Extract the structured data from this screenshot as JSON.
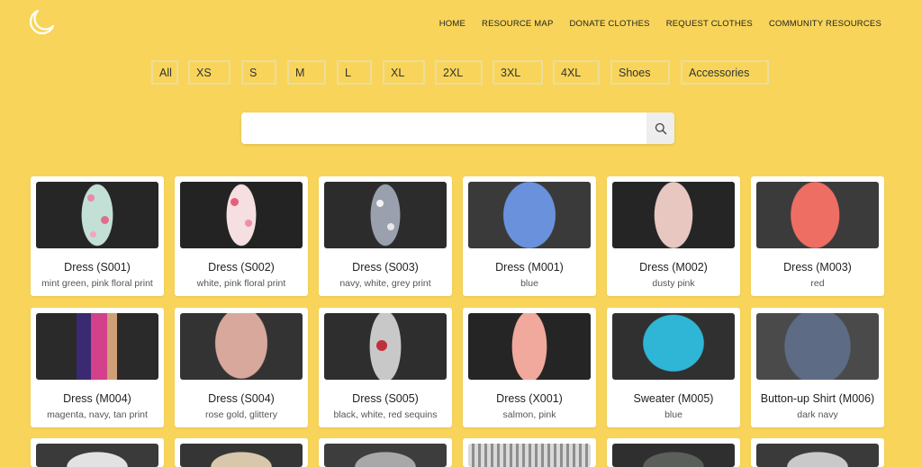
{
  "nav": {
    "home": "HOME",
    "resource_map": "RESOURCE MAP",
    "donate": "DONATE CLOTHES",
    "request": "REQUEST CLOTHES",
    "community": "COMMUNITY RESOURCES"
  },
  "filters": [
    "All",
    "XS",
    "S",
    "M",
    "L",
    "XL",
    "2XL",
    "3XL",
    "4XL",
    "Shoes",
    "Accessories"
  ],
  "search": {
    "value": "",
    "placeholder": ""
  },
  "icons": {
    "logo": "moon-icon",
    "search": "search-icon"
  },
  "colors": {
    "background": "#f8d55a",
    "card": "#ffffff"
  },
  "items": [
    {
      "name": "Dress (S001)",
      "desc": "mint green, pink floral print"
    },
    {
      "name": "Dress (S002)",
      "desc": "white, pink floral print"
    },
    {
      "name": "Dress (S003)",
      "desc": "navy, white, grey print"
    },
    {
      "name": "Dress (M001)",
      "desc": "blue"
    },
    {
      "name": "Dress (M002)",
      "desc": "dusty pink"
    },
    {
      "name": "Dress (M003)",
      "desc": "red"
    },
    {
      "name": "Dress (M004)",
      "desc": "magenta, navy, tan print"
    },
    {
      "name": "Dress (S004)",
      "desc": "rose gold, glittery"
    },
    {
      "name": "Dress (S005)",
      "desc": "black, white, red sequins"
    },
    {
      "name": "Dress (X001)",
      "desc": "salmon, pink"
    },
    {
      "name": "Sweater (M005)",
      "desc": "blue"
    },
    {
      "name": "Button-up Shirt (M006)",
      "desc": "dark navy"
    }
  ]
}
